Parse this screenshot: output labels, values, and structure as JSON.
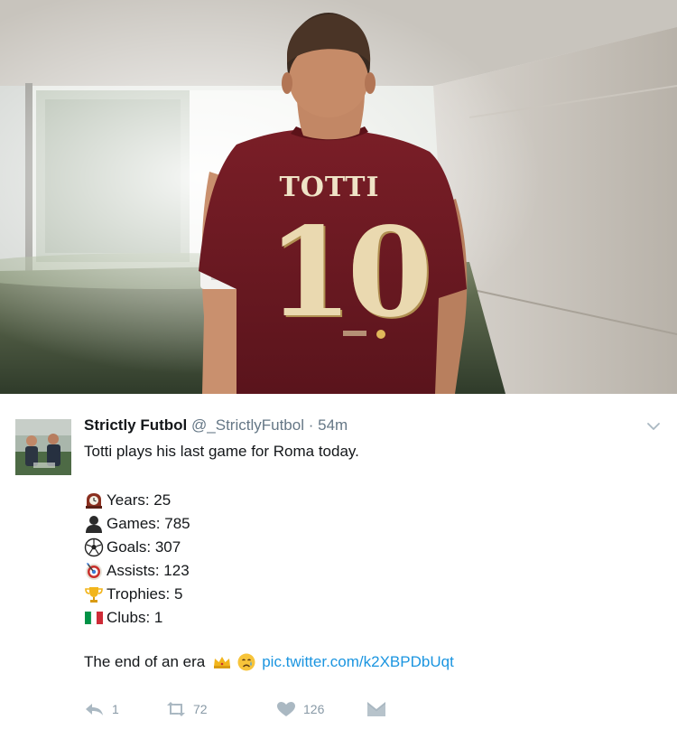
{
  "photo": {
    "jersey_name": "TOTTI",
    "jersey_number": "10"
  },
  "tweet": {
    "display_name": "Strictly Futbol",
    "handle": "@_StrictlyFutbol",
    "separator": "·",
    "timestamp": "54m",
    "text_line1": "Totti plays his last game for Roma today.",
    "stats": [
      {
        "icon": "mantelpiece-clock-icon",
        "label": "Years: 25"
      },
      {
        "icon": "bust-silhouette-icon",
        "label": "Games: 785"
      },
      {
        "icon": "soccer-ball-icon",
        "label": "Goals: 307"
      },
      {
        "icon": "target-icon",
        "label": "Assists: 123"
      },
      {
        "icon": "trophy-icon",
        "label": "Trophies: 5"
      },
      {
        "icon": "italy-flag-icon",
        "label": "Clubs: 1"
      }
    ],
    "closing_text": "The end of an era",
    "closing_emojis": [
      "crown-icon",
      "crying-face-icon"
    ],
    "pic_link": "pic.twitter.com/k2XBPDbUqt"
  },
  "actions": {
    "reply_count": "1",
    "retweet_count": "72",
    "like_count": "126"
  },
  "colors": {
    "link": "#1b95e0",
    "secondary_text": "#657786",
    "action_icon": "#aab8c2",
    "jersey": "#6b1a22"
  }
}
